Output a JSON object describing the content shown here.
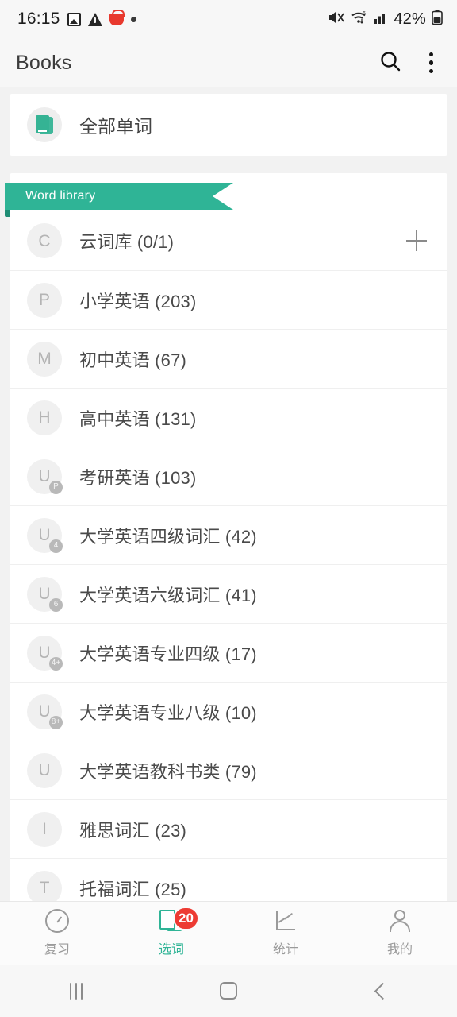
{
  "status_bar": {
    "time": "16:15",
    "battery_percent": "42%",
    "icons_left": [
      "photo-icon",
      "warning-icon",
      "shopping-basket-icon",
      "dot-icon"
    ],
    "icons_right": [
      "mute-icon",
      "wifi6-icon",
      "signal-icon",
      "battery-icon"
    ]
  },
  "app_bar": {
    "title": "Books",
    "search_icon": "search-icon",
    "overflow_icon": "kebab-menu-icon"
  },
  "all_words_card": {
    "label": "全部单词",
    "icon": "book-icon"
  },
  "library": {
    "ribbon_label": "Word library",
    "add_icon": "plus-icon",
    "rows": [
      {
        "avatar": "C",
        "badge": "",
        "label": "云词库 (0/1)",
        "has_add": true
      },
      {
        "avatar": "P",
        "badge": "",
        "label": "小学英语 (203)",
        "has_add": false
      },
      {
        "avatar": "M",
        "badge": "",
        "label": "初中英语 (67)",
        "has_add": false
      },
      {
        "avatar": "H",
        "badge": "",
        "label": "高中英语 (131)",
        "has_add": false
      },
      {
        "avatar": "U",
        "badge": "P",
        "label": "考研英语 (103)",
        "has_add": false
      },
      {
        "avatar": "U",
        "badge": "4",
        "label": "大学英语四级词汇 (42)",
        "has_add": false
      },
      {
        "avatar": "U",
        "badge": "6",
        "label": "大学英语六级词汇 (41)",
        "has_add": false
      },
      {
        "avatar": "U",
        "badge": "4+",
        "label": "大学英语专业四级 (17)",
        "has_add": false
      },
      {
        "avatar": "U",
        "badge": "8+",
        "label": "大学英语专业八级 (10)",
        "has_add": false
      },
      {
        "avatar": "U",
        "badge": "",
        "label": "大学英语教科书类 (79)",
        "has_add": false
      },
      {
        "avatar": "I",
        "badge": "",
        "label": "雅思词汇 (23)",
        "has_add": false
      },
      {
        "avatar": "T",
        "badge": "",
        "label": "托福词汇 (25)",
        "has_add": false
      }
    ]
  },
  "bottom_nav": {
    "items": [
      {
        "label": "复习",
        "icon": "clock-icon",
        "active": false,
        "badge": ""
      },
      {
        "label": "选词",
        "icon": "book-icon",
        "active": true,
        "badge": "20"
      },
      {
        "label": "统计",
        "icon": "chart-icon",
        "active": false,
        "badge": ""
      },
      {
        "label": "我的",
        "icon": "person-icon",
        "active": false,
        "badge": ""
      }
    ]
  },
  "android_nav": {
    "recents": "recents-icon",
    "home": "home-icon",
    "back": "back-icon"
  },
  "colors": {
    "accent": "#2fb496",
    "badge_red": "#ed3b33",
    "page_bg": "#f2f2f2"
  }
}
